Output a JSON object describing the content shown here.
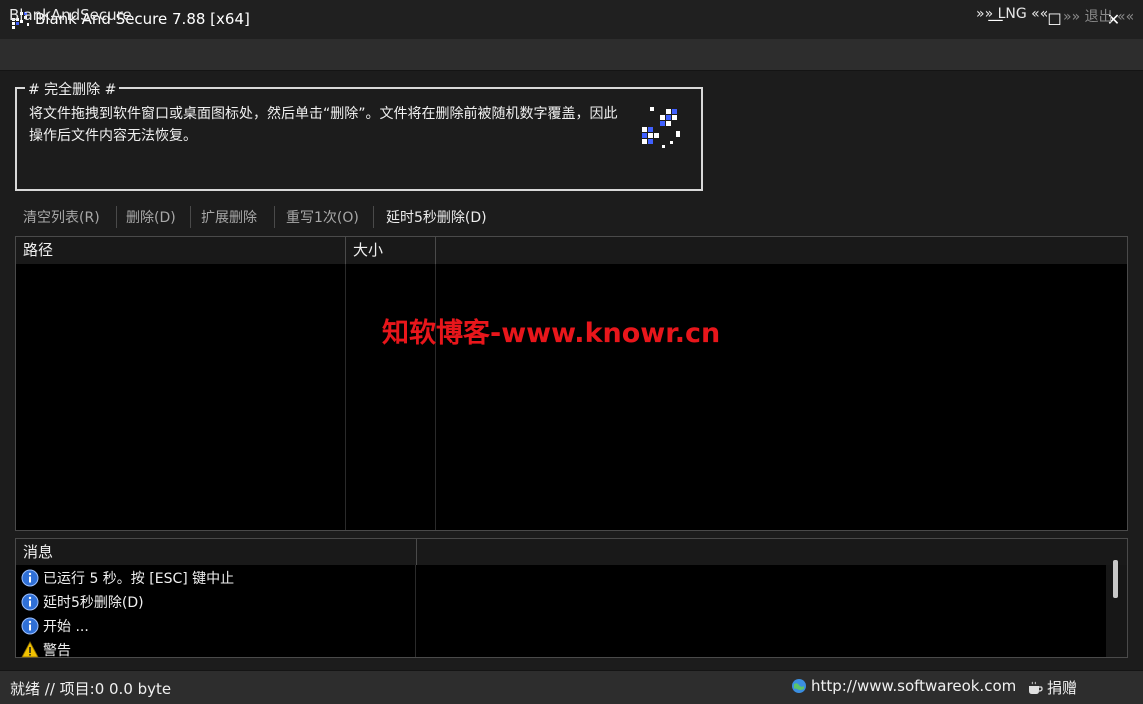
{
  "window": {
    "title": "Blank And Secure 7.88 [x64]",
    "minimize_glyph": "—",
    "maximize_glyph": "☐",
    "close_glyph": "✕"
  },
  "header": {
    "app_name": "BlankAndSecure",
    "lng_label": "»» LNG ««",
    "exit_label": "»» 退出 ««"
  },
  "group": {
    "legend": "# 完全删除 #",
    "description": "将文件拖拽到软件窗口或桌面图标处，然后单击“删除”。文件将在删除前被随机数字覆盖，因此操作后文件内容无法恢复。",
    "icon": "secure-delete-icon"
  },
  "toolbar": {
    "clear_label": "清空列表(R)",
    "delete_label": "删除(D)",
    "ext_delete_label": "扩展删除",
    "overwrite_label": "重写1次(O)",
    "delay_delete_label": "延时5秒删除(D)"
  },
  "file_list": {
    "columns": [
      "路径",
      "大小"
    ],
    "rows": []
  },
  "watermark": "知软博客-www.knowr.cn",
  "messages": {
    "column": "消息",
    "rows": [
      {
        "icon": "info-icon",
        "text": "已运行 5 秒。按 [ESC] 键中止"
      },
      {
        "icon": "info-icon",
        "text": "延时5秒删除(D)"
      },
      {
        "icon": "info-icon",
        "text": "开始 ..."
      },
      {
        "icon": "warning-icon",
        "text": "警告"
      }
    ]
  },
  "status": {
    "text": "就绪 // 项目:0 0.0 byte",
    "url": "http://www.softwareok.com",
    "donate": "捐赠"
  },
  "colors": {
    "background": "#1c1c1c",
    "list_background": "#000000",
    "watermark": "#e8161b",
    "info_blue": "#2f6fd6",
    "warning_yellow": "#f2c200"
  }
}
